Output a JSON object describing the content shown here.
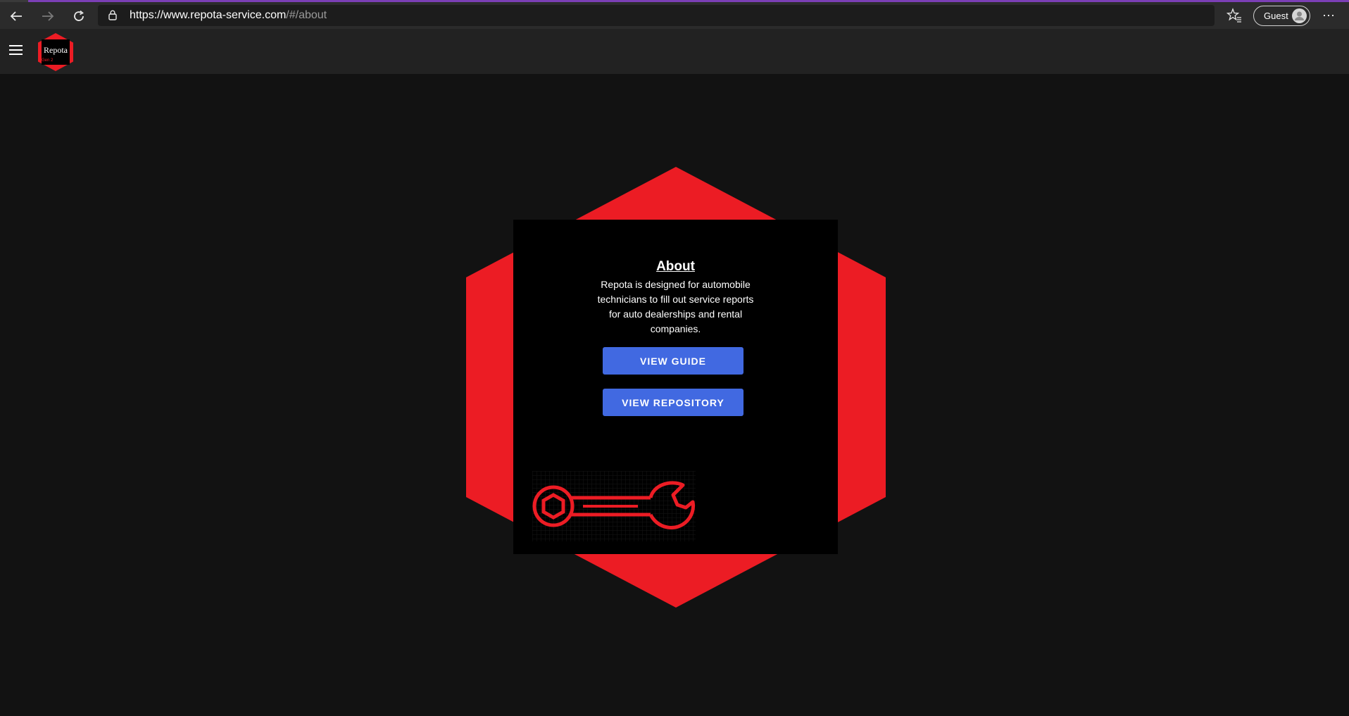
{
  "browser": {
    "url_host": "https://www.repota-service.com",
    "url_path": "/#/about",
    "profile_label": "Guest",
    "more_label": "···"
  },
  "app": {
    "logo_text": "Repota",
    "accent_color": "#ec1c24",
    "button_color": "#4169e1"
  },
  "about": {
    "title": "About",
    "description": "Repota is designed for automobile technicians to fill out service reports for auto dealerships and rental companies.",
    "guide_button": "VIEW GUIDE",
    "repo_button": "VIEW REPOSITORY"
  },
  "icons": [
    "back-arrow-icon",
    "forward-arrow-icon",
    "refresh-icon",
    "lock-icon",
    "favorites-star-icon",
    "profile-avatar-icon",
    "hamburger-menu-icon",
    "wrench-icon"
  ]
}
